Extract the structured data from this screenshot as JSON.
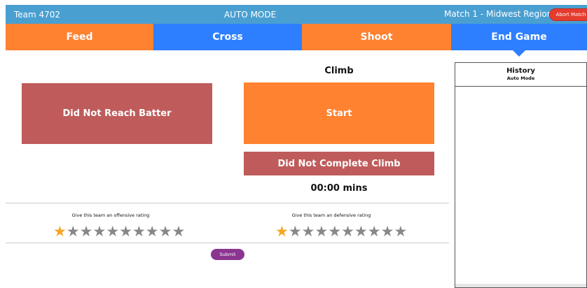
{
  "header": {
    "team": "Team 4702",
    "mode": "AUTO MODE",
    "match": "Match 1 - Midwest Regional",
    "abort_label": "Abort Match"
  },
  "tabs": [
    {
      "label": "Feed"
    },
    {
      "label": "Cross"
    },
    {
      "label": "Shoot"
    },
    {
      "label": "End Game"
    }
  ],
  "main": {
    "batter_label": "Did Not Reach Batter",
    "climb_title": "Climb",
    "start_label": "Start",
    "climb_fail_label": "Did Not Complete Climb",
    "timer": "00:00 mins"
  },
  "ratings": {
    "offensive_label": "Give this team an offensive rating",
    "defensive_label": "Give this team an defensive rating",
    "offensive_value": 1,
    "defensive_value": 1,
    "max_stars": 10,
    "star_glyph": "★"
  },
  "submit_label": "Submit",
  "history": {
    "title": "History",
    "subtitle": "Auto Mode"
  },
  "colors": {
    "header_blue": "#4a9fd1",
    "tab_orange": "#ff8230",
    "tab_blue": "#2d7fff",
    "button_red": "#bf5b5b",
    "abort_red": "#e53c2e",
    "submit_purple": "#8a3590",
    "star_active": "#f5a623",
    "star_inactive": "#888888"
  }
}
